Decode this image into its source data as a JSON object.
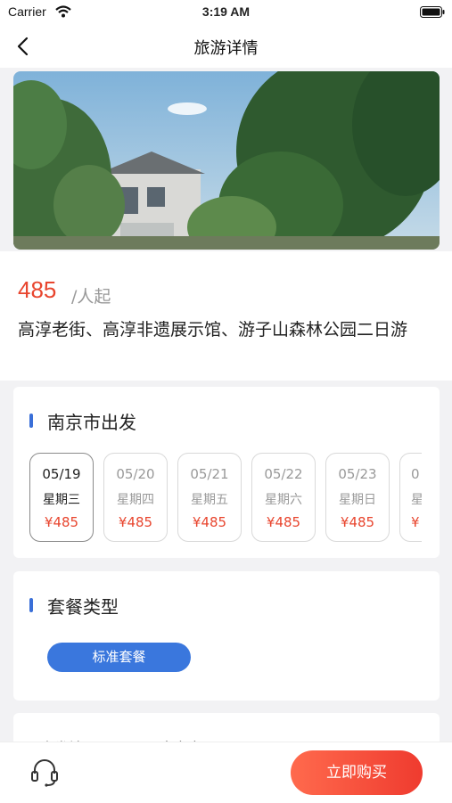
{
  "status_bar": {
    "carrier": "Carrier",
    "time": "3:19 AM"
  },
  "nav": {
    "title": "旅游详情"
  },
  "hero": {
    "alt": "旅游景点照片"
  },
  "product": {
    "price": "485",
    "price_unit": "/人起",
    "title": "高淳老街、高淳非遗展示馆、游子山森林公园二日游"
  },
  "departure": {
    "heading": "南京市出发",
    "dates": [
      {
        "date": "05/19",
        "weekday": "星期三",
        "price": "¥485",
        "selected": true
      },
      {
        "date": "05/20",
        "weekday": "星期四",
        "price": "¥485",
        "selected": false
      },
      {
        "date": "05/21",
        "weekday": "星期五",
        "price": "¥485",
        "selected": false
      },
      {
        "date": "05/22",
        "weekday": "星期六",
        "price": "¥485",
        "selected": false
      },
      {
        "date": "05/23",
        "weekday": "星期日",
        "price": "¥485",
        "selected": false
      },
      {
        "date": "0",
        "weekday": "星",
        "price": "¥",
        "selected": false
      }
    ]
  },
  "package": {
    "heading": "套餐类型",
    "option": "标准套餐"
  },
  "details_peek": {
    "label": "出发地",
    "value": "南京市"
  },
  "bottom": {
    "cs_icon": "headset-icon",
    "buy_label": "立即购买"
  },
  "colors": {
    "accent_blue": "#3a77dd",
    "price_red": "#e8452e",
    "buy_red": "#ef3b2f"
  }
}
